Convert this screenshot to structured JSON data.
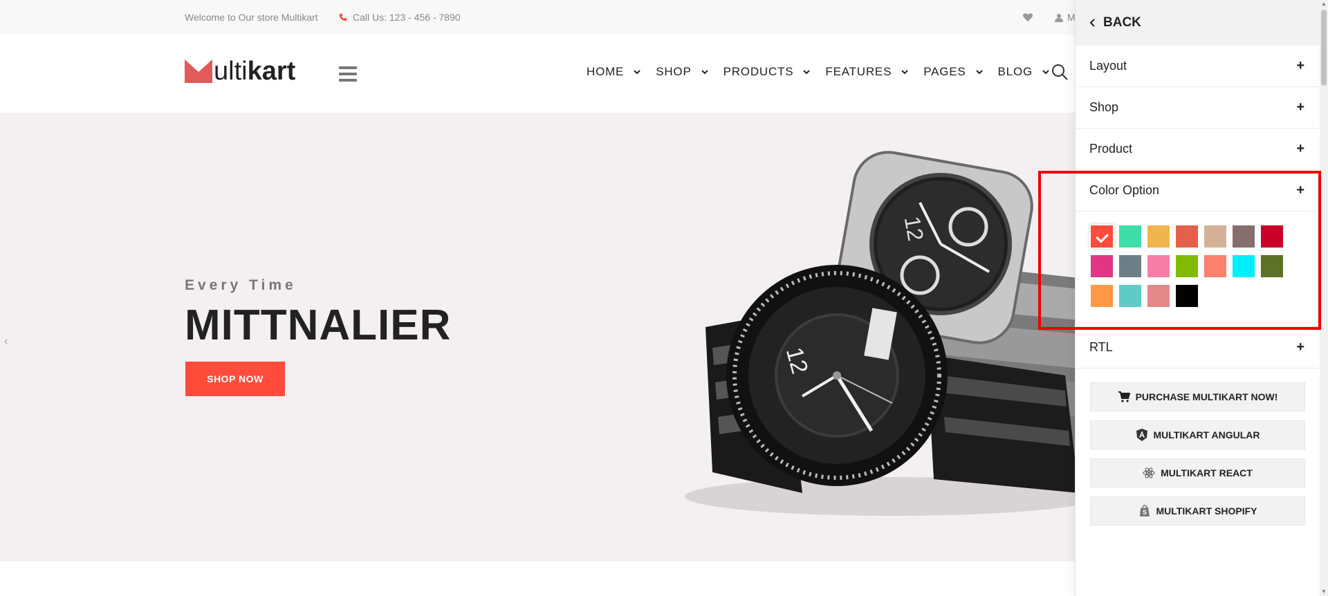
{
  "topbar": {
    "welcome": "Welcome to Our store Multikart",
    "call": "Call Us: 123 - 456 - 7890",
    "user_initial": "M"
  },
  "header": {
    "logo_ulti": "ulti",
    "logo_kart": "kart",
    "nav": [
      "HOME",
      "SHOP",
      "PRODUCTS",
      "FEATURES",
      "PAGES",
      "BLOG"
    ]
  },
  "hero": {
    "eyebrow": "Every Time",
    "headline": "MITTNALIER",
    "button": "SHOP NOW",
    "prev_arrow": "‹"
  },
  "panel": {
    "back": "BACK",
    "sections": [
      "Layout",
      "Shop",
      "Product",
      "Color Option",
      "RTL"
    ],
    "plus": "+",
    "swatches": [
      [
        "#ff4c3b",
        "#3fdda7",
        "#f0b54d",
        "#e4604a",
        "#d4b196",
        "#866e6c",
        "#cb0029"
      ],
      [
        "#e03685",
        "#6d7e87",
        "#f67ea6",
        "#81ba00",
        "#fe816d",
        "#01effc",
        "#5d7227"
      ],
      [
        "#ff9944",
        "#5fcbc4",
        "#e38888",
        "#000000"
      ]
    ],
    "selected_swatch": "#ff4c3b",
    "actions": [
      "PURCHASE MULTIKART NOW!",
      "MULTIKART ANGULAR",
      "MULTIKART REACT",
      "MULTIKART SHOPIFY"
    ]
  },
  "colors": {
    "accent": "#ff4c3b",
    "highlight": "#ee0000"
  }
}
